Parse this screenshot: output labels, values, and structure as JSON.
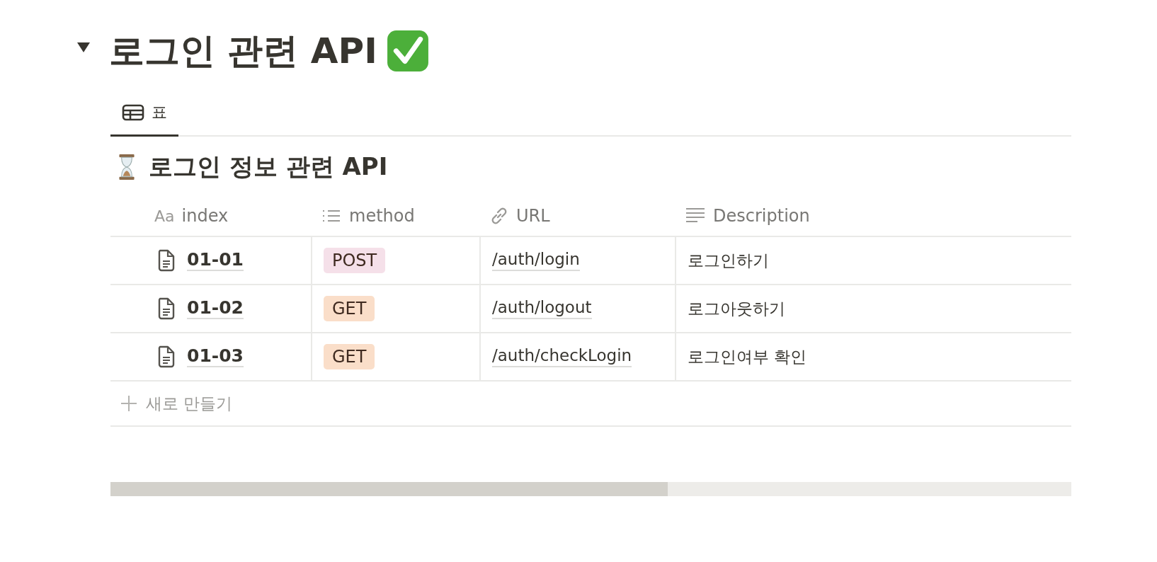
{
  "toggle": {
    "expanded": true
  },
  "heading": {
    "title": "로그인 관련 API",
    "done": true
  },
  "tabs": [
    {
      "label": "표",
      "selected": true
    }
  ],
  "table": {
    "title": "로그인 정보 관련 API",
    "pending": true,
    "columns": [
      {
        "kind": "title",
        "type_label": "Aa",
        "label": "index"
      },
      {
        "kind": "select",
        "label": "method"
      },
      {
        "kind": "url",
        "label": "URL"
      },
      {
        "kind": "text",
        "label": "Description"
      }
    ],
    "rows": [
      {
        "index": "01-01",
        "method": {
          "label": "POST",
          "color": "#f5e0e9"
        },
        "url": "/auth/login",
        "description": "로그인하기"
      },
      {
        "index": "01-02",
        "method": {
          "label": "GET",
          "color": "#fadec9"
        },
        "url": "/auth/logout",
        "description": "로그아웃하기"
      },
      {
        "index": "01-03",
        "method": {
          "label": "GET",
          "color": "#fadec9"
        },
        "url": "/auth/checkLogin",
        "description": "로그인여부 확인"
      }
    ],
    "new_row": "새로 만들기"
  }
}
